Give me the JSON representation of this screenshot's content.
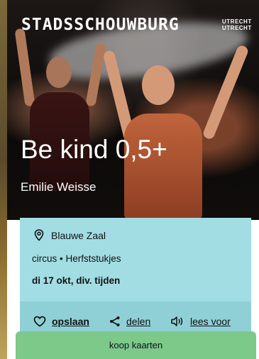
{
  "brand": {
    "logo_text": "STADSSCHOUWBURG",
    "logo_sub_line1": "UTRECHT",
    "logo_sub_line2": "UTRECHT"
  },
  "show": {
    "title": "Be kind 0,5+",
    "performer": "Emilie Weisse"
  },
  "info": {
    "venue": "Blauwe Zaal",
    "genre": "circus • Herfststukjes",
    "dates": "di 17 okt, div. tijden"
  },
  "actions": {
    "save_label": "opslaan",
    "share_label": "delen",
    "read_label": "lees voor"
  },
  "cta": {
    "buy_label": "koop kaarten"
  },
  "colors": {
    "info_card": "#a2dde3",
    "actions_bar": "#8fd0d6",
    "buy_button": "#7cc98a"
  }
}
